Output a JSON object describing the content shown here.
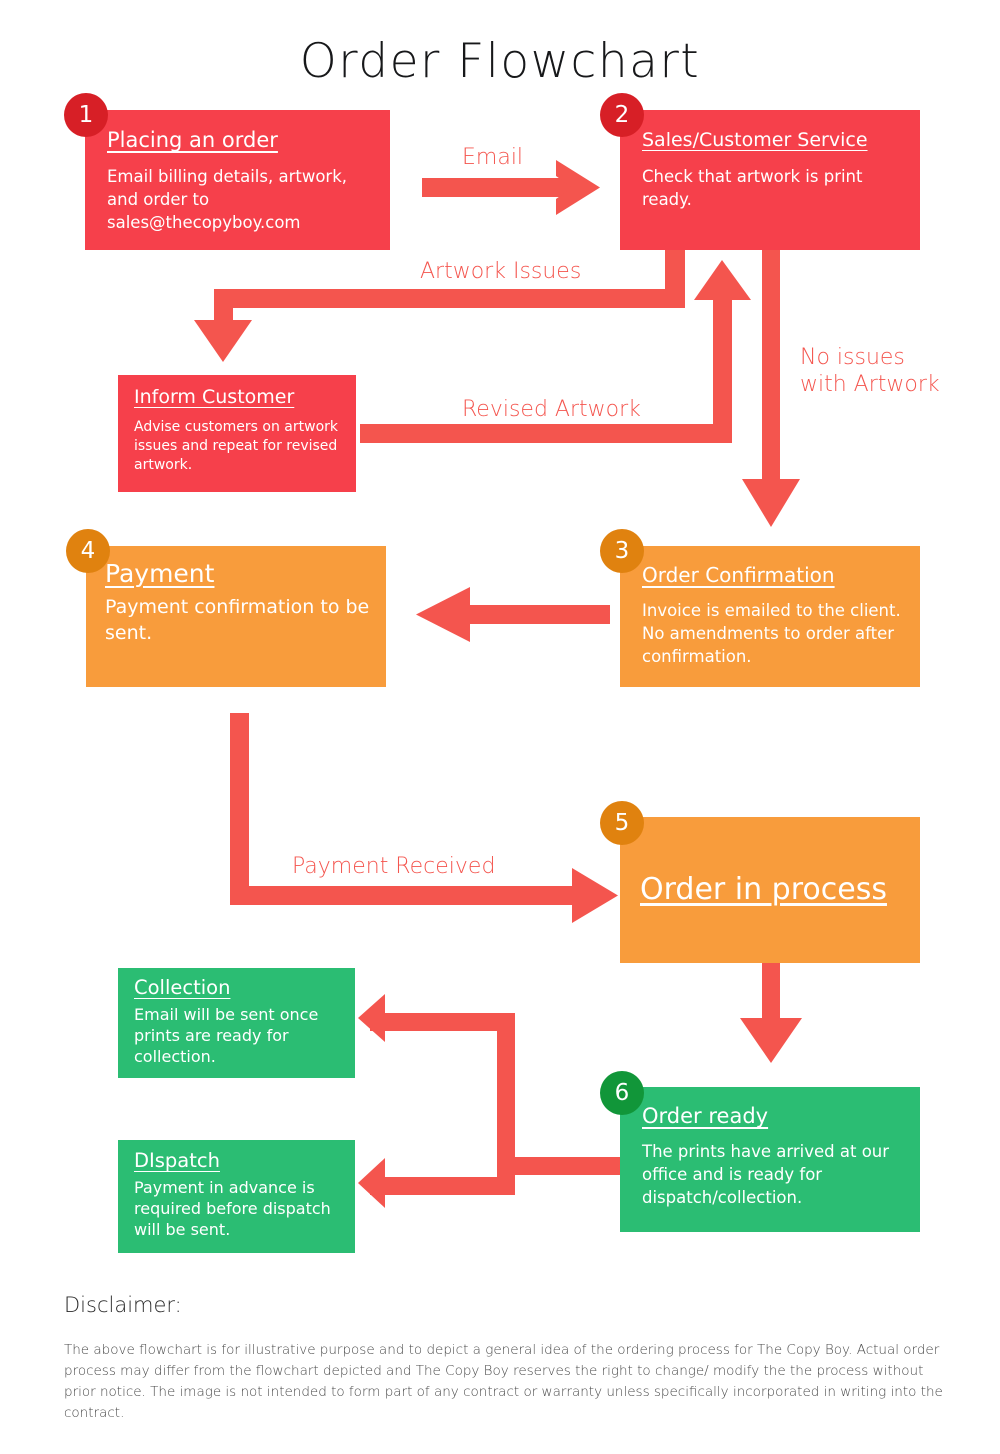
{
  "page": {
    "title": "Order Flowchart",
    "background": "#ffffff"
  },
  "colors": {
    "red_box": "#F6404B",
    "red_badge": "#D71F26",
    "orange_box": "#F89C3C",
    "orange_badge": "#E0820F",
    "green_box": "#2BBD73",
    "green_badge": "#119639",
    "arrow": "#F4554E",
    "label_text": "#F4554E",
    "box_text": "#FFFFFF",
    "title_text": "#17181A",
    "disclaimer_text": "#4A4A4A"
  },
  "nodes": [
    {
      "number": "1",
      "title": "Placing an order",
      "body": "Email billing details, artwork, and order to sales@thecopyboy.com",
      "color": "red"
    },
    {
      "number": "2",
      "title": "Sales/Customer Service",
      "body": "Check that artwork is print ready.",
      "color": "red"
    },
    {
      "number": "",
      "title": "Inform Customer",
      "body": "Advise customers on artwork issues and repeat for revised artwork.",
      "color": "red"
    },
    {
      "number": "4",
      "title": "Payment",
      "body": "Payment confirmation to be sent.",
      "color": "orange"
    },
    {
      "number": "3",
      "title": "Order Confirmation",
      "body": "Invoice is emailed to the client. No amendments to order after confirmation.",
      "color": "orange"
    },
    {
      "number": "5",
      "title": "Order in process",
      "body": "",
      "color": "orange"
    },
    {
      "number": "",
      "title": "Collection",
      "body": "Email will be sent once prints are ready for collection.",
      "color": "green"
    },
    {
      "number": "",
      "title": "DIspatch",
      "body": "Payment in advance is required before dispatch will be sent.",
      "color": "green"
    },
    {
      "number": "6",
      "title": "Order ready",
      "body": "The prints have arrived at our office and is ready for dispatch/collection.",
      "color": "green"
    }
  ],
  "edges": [
    {
      "label": "Email"
    },
    {
      "label": "Artwork Issues"
    },
    {
      "label": "No issues\nwith Artwork"
    },
    {
      "label": "Revised Artwork"
    },
    {
      "label": "Payment Received"
    }
  ],
  "disclaimer": {
    "heading": "Disclaimer:",
    "text": "The above flowchart is for illustrative purpose and to depict a general idea of the ordering process for The Copy Boy. Actual order process may differ from the flowchart depicted and The Copy Boy reserves the right to change/ modify the the process without prior notice. The image is not intended to form part of any contract or warranty unless specifically incorporated in writing into the contract."
  }
}
